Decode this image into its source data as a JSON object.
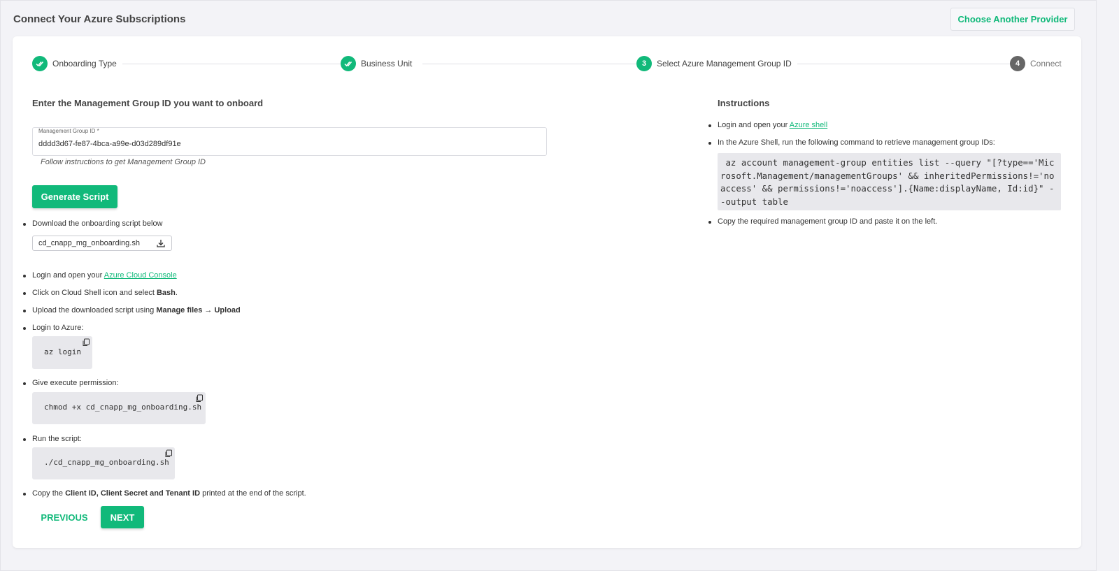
{
  "header": {
    "title": "Connect Your Azure Subscriptions",
    "choose_provider_label": "Choose Another Provider"
  },
  "stepper": {
    "steps": [
      {
        "number": "1",
        "label": "Onboarding Type",
        "state": "done"
      },
      {
        "number": "2",
        "label": "Business Unit",
        "state": "done"
      },
      {
        "number": "3",
        "label": "Select Azure Management Group ID",
        "state": "active"
      },
      {
        "number": "4",
        "label": "Connect",
        "state": "pending"
      }
    ]
  },
  "form": {
    "heading": "Enter the Management Group ID you want to onboard",
    "field_label": "Management Group ID *",
    "field_value": "dddd3d67-fe87-4bca-a99e-d03d289df91e",
    "helper_text": "Follow instructions to get Management Group ID",
    "generate_label": "Generate Script"
  },
  "steps_list": {
    "download_text": "Download the onboarding script below",
    "file_name": "cd_cnapp_mg_onboarding.sh",
    "login_prefix": "Login and open your ",
    "login_link": "Azure Cloud Console",
    "cloudshell_prefix": "Click on Cloud Shell icon and select ",
    "cloudshell_bold": "Bash",
    "cloudshell_suffix": ".",
    "upload_prefix": "Upload the downloaded script using ",
    "upload_bold": "Manage files → Upload",
    "login_azure_text": "Login to Azure:",
    "login_azure_code": "az login",
    "exec_text": "Give execute permission:",
    "exec_code": "chmod +x cd_cnapp_mg_onboarding.sh",
    "run_text": "Run the script:",
    "run_code": "./cd_cnapp_mg_onboarding.sh",
    "copy_prefix": "Copy the ",
    "copy_bold": "Client ID, Client Secret and Tenant ID",
    "copy_suffix": " printed at the end of the script."
  },
  "nav": {
    "previous_label": "PREVIOUS",
    "next_label": "NEXT"
  },
  "instructions": {
    "heading": "Instructions",
    "item1_prefix": "Login and open your ",
    "item1_link": "Azure shell",
    "item2_text": "In the Azure Shell, run the following command to retrieve management group IDs:",
    "command": " az account management-group entities list --query \"[?type=='Microsoft.Management/managementGroups' && inheritedPermissions!='noaccess' && permissions!='noaccess'].{Name:displayName, Id:id}\" --output table",
    "item3_text": "Copy the required management group ID and paste it on the left."
  },
  "colors": {
    "accent": "#11b97a",
    "pending_step": "#666666",
    "code_bg": "#e8e8ec"
  }
}
